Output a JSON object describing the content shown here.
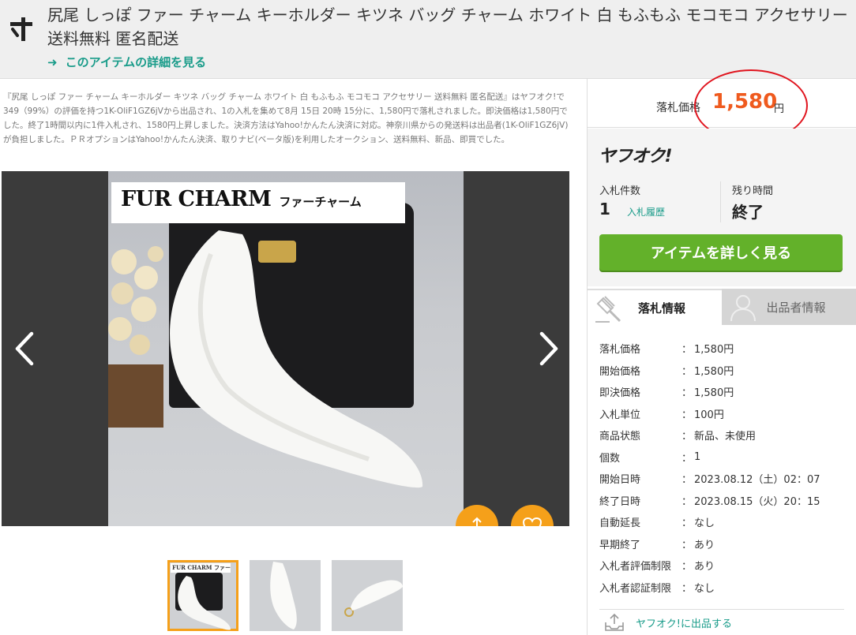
{
  "header": {
    "title": "尻尾 しっぽ ファー チャーム キーホルダー キツネ バッグ チャーム ホワイト 白 もふもふ モコモコ アクセサリー 送料無料 匿名配送",
    "detail_link": "このアイテムの詳細を見る"
  },
  "description": "『尻尾 しっぽ ファー チャーム キーホルダー キツネ バッグ チャーム ホワイト 白 もふもふ モコモコ アクセサリー 送料無料 匿名配送』はヤフオク!で349（99%）の評価を持つ1K-OliF1GZ6jVから出品され、1の入札を集めて8月 15日 20時 15分に、1,580円で落札されました。即決価格は1,580円でした。終了1時間以内に1件入札され、1580円上昇しました。決済方法はYahoo!かんたん決済に対応。神奈川県からの発送料は出品者(1K-OliF1GZ6jV)が負担しました。ＰＲオプションはYahoo!かんたん決済、取りナビ(ベータ版)を利用したオークション、送料無料、新品、即買でした。",
  "image": {
    "caption_big": "FUR CHARM",
    "caption_small": "ファーチャーム",
    "thumb_caption": "FUR CHARM ファーチャーム"
  },
  "price": {
    "label": "落札価格",
    "value": "1,580",
    "unit": "円"
  },
  "auction": {
    "brand": "ヤフオク!",
    "bids_label": "入札件数",
    "bids_value": "1",
    "history_link": "入札履歴",
    "time_label": "残り時間",
    "time_value": "終了",
    "detail_button": "アイテムを詳しく見る"
  },
  "tabs": [
    {
      "label": "落札情報",
      "active": true
    },
    {
      "label": "出品者情報",
      "active": false
    }
  ],
  "info": [
    {
      "key": "落札価格",
      "value": "1,580円"
    },
    {
      "key": "開始価格",
      "value": "1,580円"
    },
    {
      "key": "即決価格",
      "value": "1,580円"
    },
    {
      "key": "入札単位",
      "value": "100円"
    },
    {
      "key": "商品状態",
      "value": "新品、未使用"
    },
    {
      "key": "個数",
      "value": "1"
    },
    {
      "key": "開始日時",
      "value": "2023.08.12（土）02：07"
    },
    {
      "key": "終了日時",
      "value": "2023.08.15（火）20：15"
    },
    {
      "key": "自動延長",
      "value": "なし"
    },
    {
      "key": "早期終了",
      "value": "あり"
    },
    {
      "key": "入札者評価制限",
      "value": "あり"
    },
    {
      "key": "入札者認証制限",
      "value": "なし"
    }
  ],
  "info_separator": "：",
  "sell_link": "ヤフオク!に出品する",
  "colors": {
    "accent_orange": "#f5a01a",
    "price_orange": "#ef5a1e",
    "green_button": "#63b12a",
    "link_teal": "#1a9c8a",
    "highlight_red": "#e0141e"
  },
  "icons": [
    "yahoo-y-logo-icon",
    "arrow-right-icon",
    "chevron-left-icon",
    "chevron-right-icon",
    "share-icon",
    "heart-icon",
    "gavel-icon",
    "user-icon",
    "upload-icon"
  ]
}
